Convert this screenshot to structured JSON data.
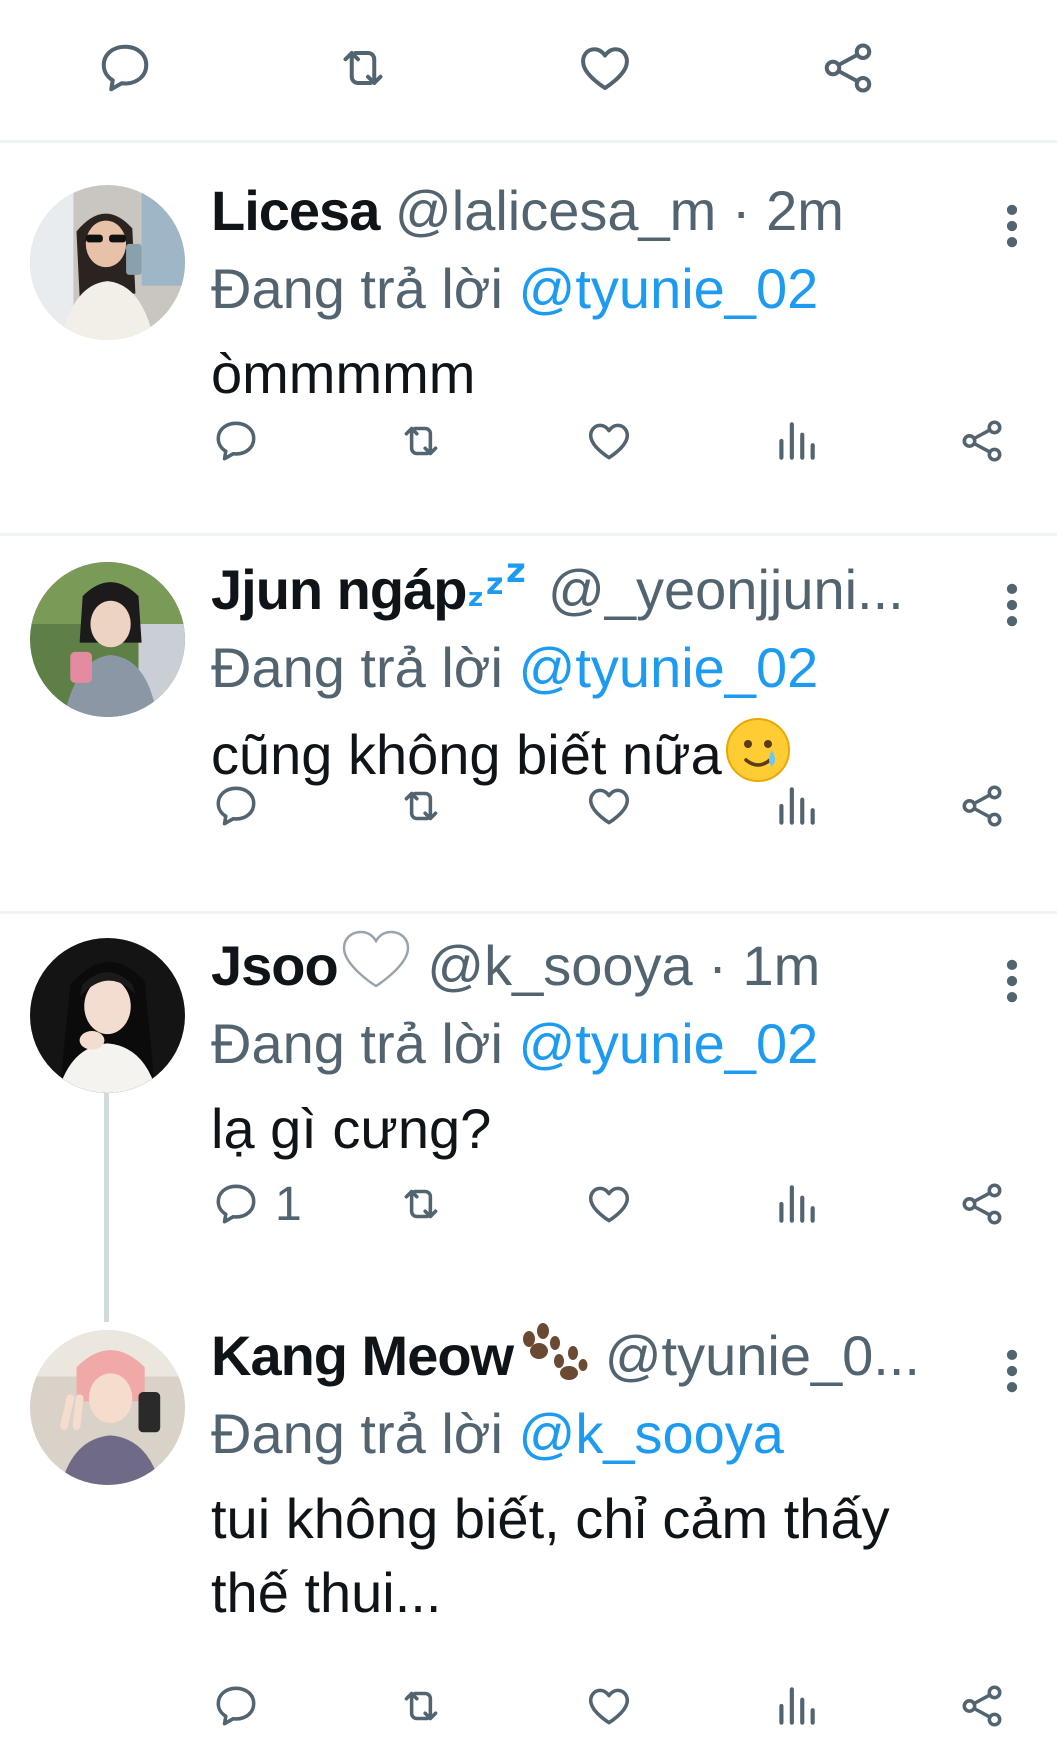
{
  "tweets": [
    {
      "name": "Licesa",
      "handle": "@lalicesa_m",
      "time_sep": " · ",
      "time": "2m",
      "name_emoji": "",
      "replying_prefix": "Đang trả lời ",
      "replying_to": "@tyunie_02",
      "text": "òmmmmm",
      "reply_count": ""
    },
    {
      "name": "Jjun ngáp",
      "name_emoji": "zzz-emoji",
      "handle": "@_yeonjjuni...",
      "time_sep": "",
      "time": "",
      "replying_prefix": "Đang trả lời ",
      "replying_to": "@tyunie_02",
      "text": "cũng không biết nữa",
      "text_emoji": "smiling-face-with-tear-emoji",
      "reply_count": ""
    },
    {
      "name": "Jsoo",
      "name_emoji": "white-heart-emoji",
      "handle": "@k_sooya",
      "time_sep": " · ",
      "time": "1m",
      "replying_prefix": "Đang trả lời ",
      "replying_to": "@tyunie_02",
      "text": "lạ gì cưng?",
      "reply_count": "1"
    },
    {
      "name": "Kang Meow",
      "name_emoji": "paw-prints-emoji",
      "handle": "@tyunie_0...",
      "time_sep": "",
      "time": "",
      "replying_prefix": "Đang trả lời ",
      "replying_to": "@k_sooya",
      "text_line1": "tui không biết, chỉ cảm thấy",
      "text_line2": "thế thui...",
      "reply_count": ""
    }
  ],
  "icons": {
    "reply": "reply-icon",
    "retweet": "retweet-icon",
    "like": "heart-icon",
    "views": "views-icon",
    "share": "share-icon",
    "more": "more-vertical-icon"
  },
  "colors": {
    "text": "#0f1419",
    "secondary": "#536471",
    "accent": "#1d9bf0",
    "divider": "#eff3f4"
  }
}
